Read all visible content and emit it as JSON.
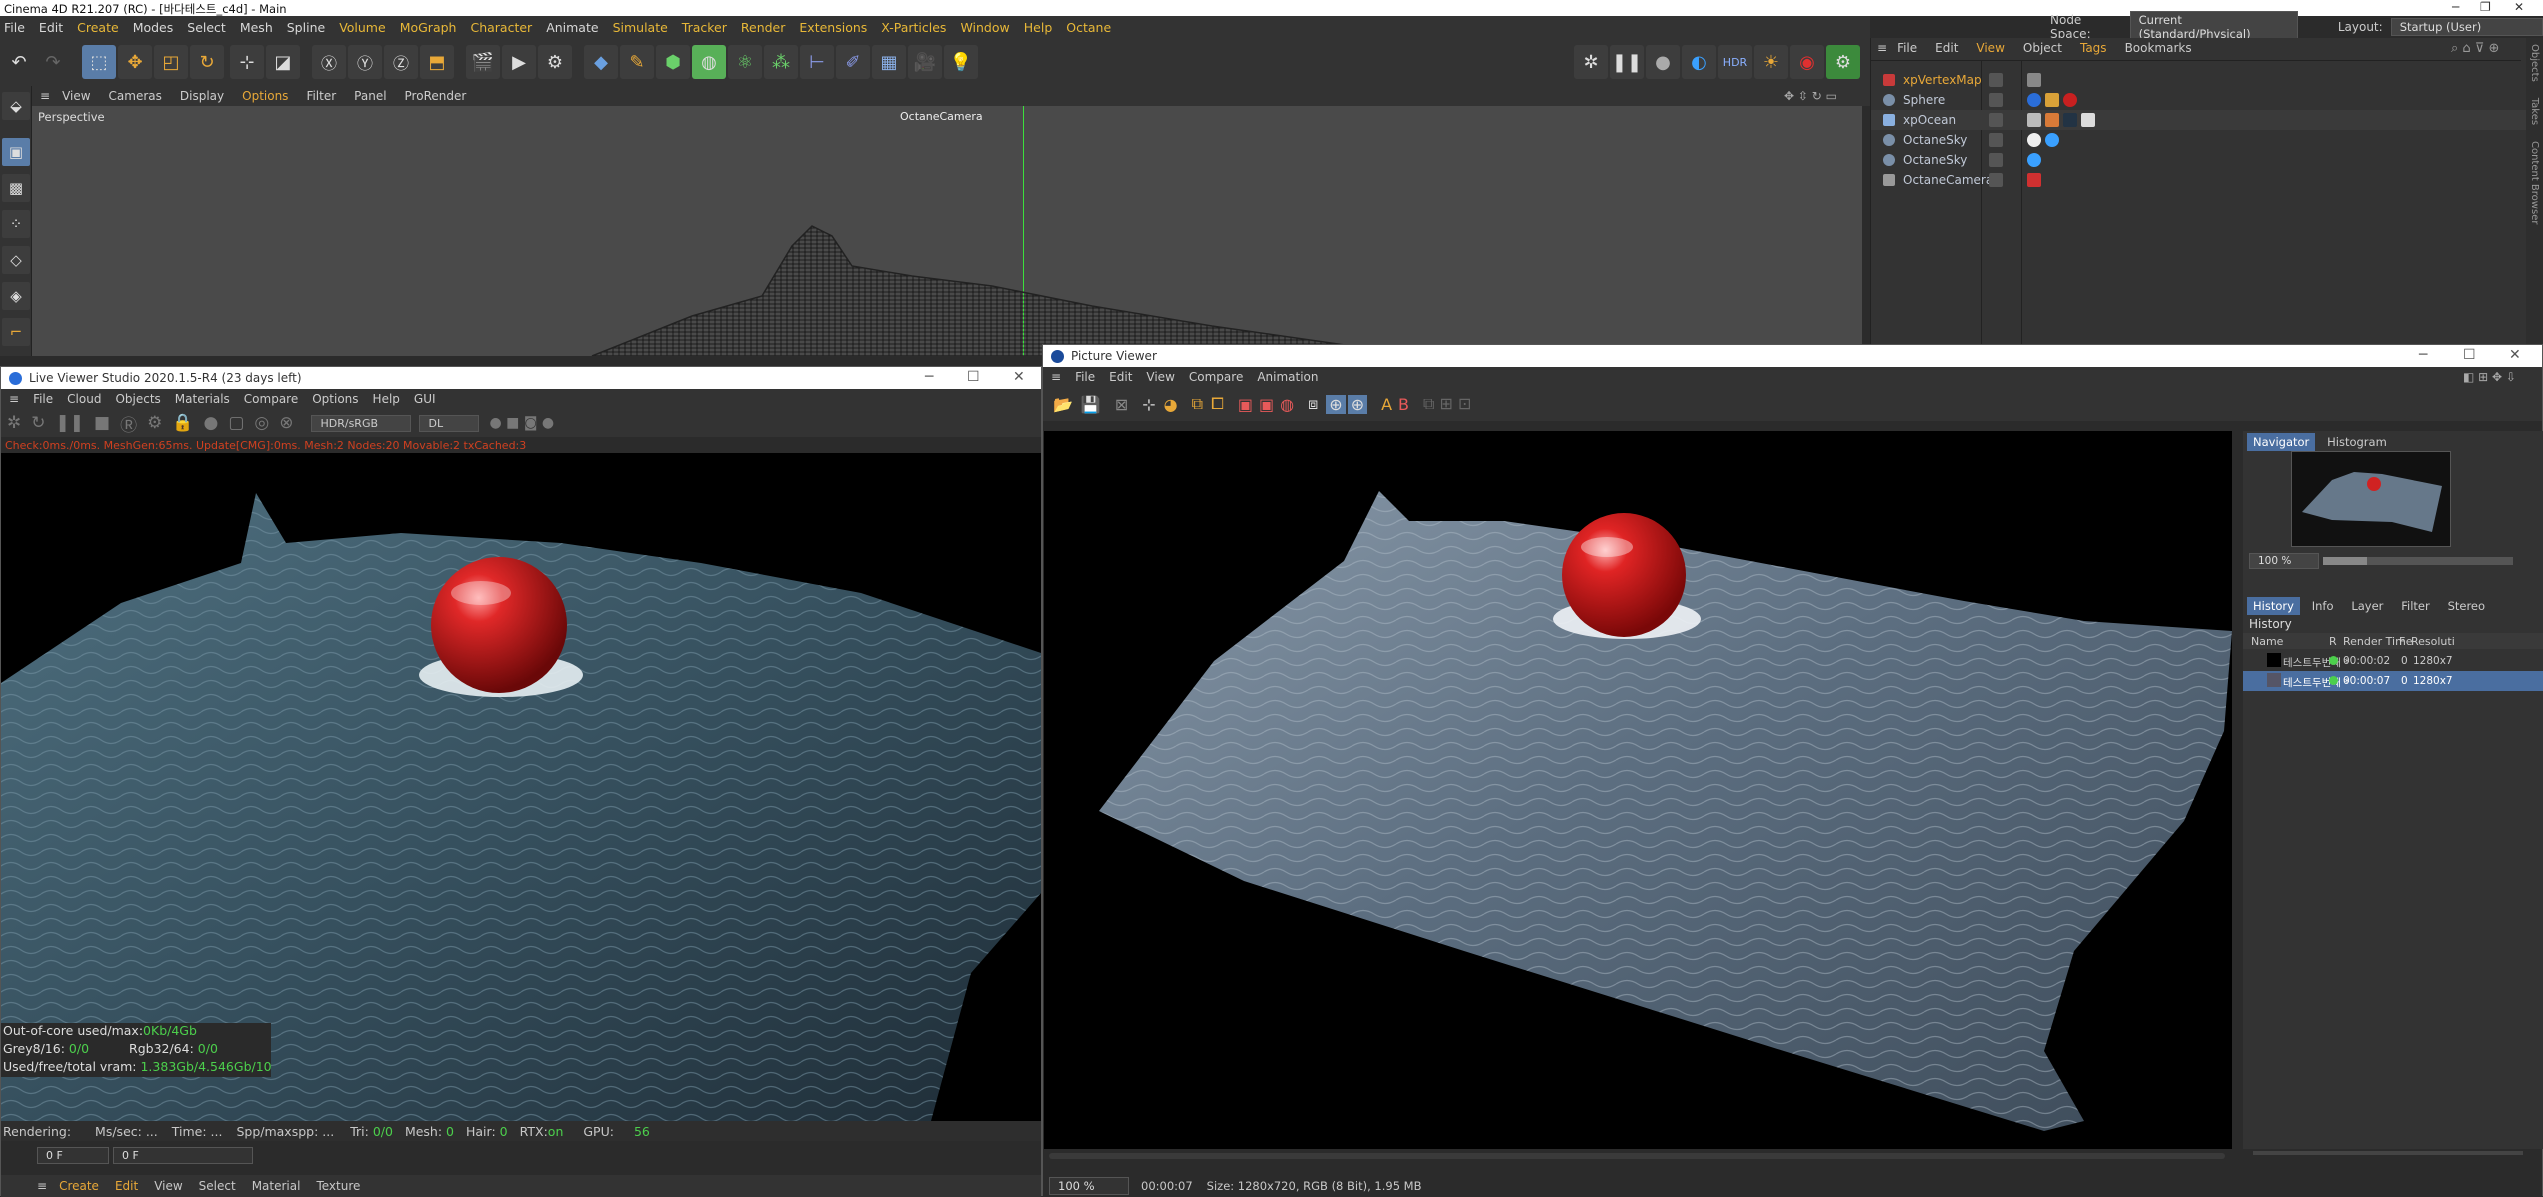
{
  "window": {
    "title": "Cinema 4D R21.207 (RC) - [바다테스트_c4d] - Main"
  },
  "menubar": {
    "items": [
      "File",
      "Edit",
      "Create",
      "Modes",
      "Select",
      "Mesh",
      "Spline",
      "Volume",
      "MoGraph",
      "Character",
      "Animate",
      "Simulate",
      "Tracker",
      "Render",
      "Extensions",
      "X-Particles",
      "Window",
      "Help",
      "Octane"
    ],
    "node_space_label": "Node Space:",
    "node_space_value": "Current (Standard/Physical)",
    "layout_label": "Layout:",
    "layout_value": "Startup (User)"
  },
  "viewport": {
    "menu": [
      "View",
      "Cameras",
      "Display",
      "Options",
      "Filter",
      "Panel",
      "ProRender"
    ],
    "label": "Perspective",
    "camera": "OctaneCamera"
  },
  "object_manager": {
    "menu": [
      "File",
      "Edit",
      "View",
      "Object",
      "Tags",
      "Bookmarks"
    ],
    "objects": [
      {
        "name": "xpVertexMap",
        "selected": true
      },
      {
        "name": "Sphere",
        "selected": false
      },
      {
        "name": "xpOcean",
        "selected": false
      },
      {
        "name": "OctaneSky",
        "selected": false
      },
      {
        "name": "OctaneSky",
        "selected": false
      },
      {
        "name": "OctaneCamera",
        "selected": false
      }
    ],
    "side_tabs": [
      "Objects",
      "Takes",
      "Content Browser"
    ]
  },
  "live_viewer": {
    "title": "Live Viewer Studio 2020.1.5-R4 (23 days left)",
    "menu": [
      "File",
      "Cloud",
      "Objects",
      "Materials",
      "Compare",
      "Options",
      "Help",
      "GUI"
    ],
    "mode_value": "HDR/sRGB",
    "kernel_value": "DL",
    "status_line": "Check:0ms./0ms. MeshGen:65ms. Update[CMG]:0ms. Mesh:2 Nodes:20 Movable:2 txCached:3",
    "stats": {
      "ooc_label": "Out-of-core used/max:",
      "ooc_value": "0Kb/4Gb",
      "grey_label": "Grey8/16:",
      "grey_value": "0/0",
      "rgb_label": "Rgb32/64:",
      "rgb_value": "0/0",
      "vram_label": "Used/free/total vram:",
      "vram_value": "1.383Gb/4.546Gb/10Gb"
    },
    "render_bar": {
      "rendering": "Rendering:",
      "msec": "Ms/sec: ...",
      "time": "Time: ...",
      "spp": "Spp/maxspp: ...",
      "tri_label": "Tri:",
      "tri_value": "0/0",
      "mesh_label": "Mesh:",
      "mesh_value": "0",
      "hair_label": "Hair:",
      "hair_value": "0",
      "rtx_label": "RTX:",
      "rtx_value": "on",
      "gpu_label": "GPU:",
      "gpu_value": "56"
    },
    "frame_field": "0 F",
    "frame_field2": "0 F"
  },
  "bottom_menu": [
    "Create",
    "Edit",
    "View",
    "Select",
    "Material",
    "Texture"
  ],
  "picture_viewer": {
    "title": "Picture Viewer",
    "menu": [
      "File",
      "Edit",
      "View",
      "Compare",
      "Animation"
    ],
    "zoom": "100 %",
    "time": "00:00:07",
    "size_info": "Size: 1280x720, RGB (8 Bit), 1.95 MB",
    "nav_tabs": [
      "Navigator",
      "Histogram"
    ],
    "nav_zoom": "100 %",
    "tabs": [
      "History",
      "Info",
      "Layer",
      "Filter",
      "Stereo"
    ],
    "history_title": "History",
    "history_cols": [
      "Name",
      "R",
      "Render Time",
      "F",
      "Resoluti"
    ],
    "history_rows": [
      {
        "name": "테스트두번째 *",
        "time": "00:00:02",
        "frame": "0",
        "res": "1280x7"
      },
      {
        "name": "테스트두번째 *",
        "time": "00:00:07",
        "frame": "0",
        "res": "1280x7"
      }
    ]
  },
  "colors": {
    "accent": "#e8a838",
    "selection": "#4a6ea0",
    "green": "#4ccf4c",
    "sphere_red": "#c8181c"
  }
}
